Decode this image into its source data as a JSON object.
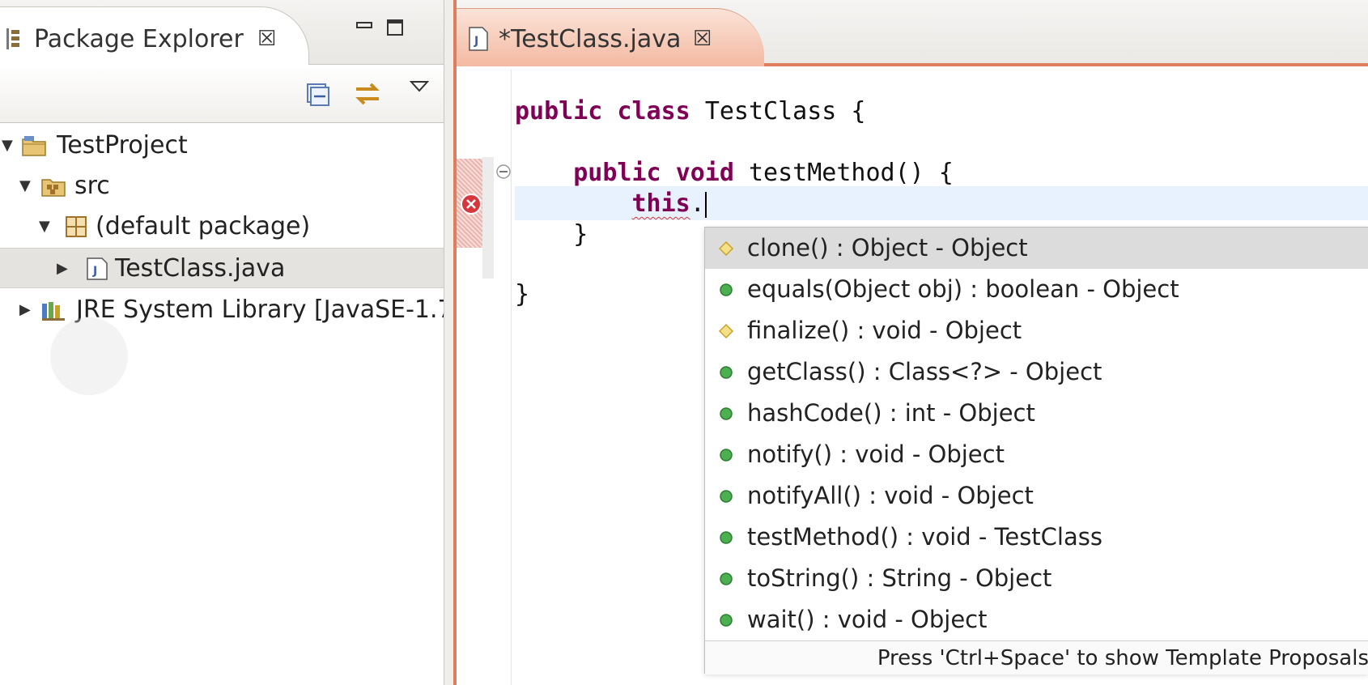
{
  "explorer": {
    "tab_title": "Package Explorer",
    "close_glyph": "☒",
    "tree": [
      {
        "label": "TestProject",
        "twisty": "▼",
        "icon": "project-folder-icon"
      },
      {
        "label": "src",
        "twisty": "▼",
        "icon": "source-folder-icon"
      },
      {
        "label": "(default package)",
        "twisty": "▼",
        "icon": "package-icon"
      },
      {
        "label": "TestClass.java",
        "twisty": "▶",
        "icon": "java-file-icon",
        "selected": true
      },
      {
        "label": "JRE System Library [JavaSE-1.7",
        "twisty": "▶",
        "icon": "library-icon"
      }
    ]
  },
  "editor": {
    "tab_title": "*TestClass.java",
    "close_glyph": "☒",
    "code": {
      "line1_kw1": "public",
      "line1_kw2": "class",
      "line1_rest": "TestClass {",
      "line2_kw1": "public",
      "line2_kw2": "void",
      "line2_rest": "testMethod() {",
      "line3_kw": "this",
      "line3_rest": ".",
      "line4": "}",
      "line5": "}"
    }
  },
  "assist": {
    "proposals": [
      {
        "text": "clone() : Object - Object",
        "icon": "protected-method-icon",
        "selected": true
      },
      {
        "text": "equals(Object obj) : boolean - Object",
        "icon": "public-method-icon"
      },
      {
        "text": "finalize() : void - Object",
        "icon": "protected-method-icon"
      },
      {
        "text": "getClass() : Class<?> - Object",
        "icon": "public-method-icon"
      },
      {
        "text": "hashCode() : int - Object",
        "icon": "public-method-icon"
      },
      {
        "text": "notify() : void - Object",
        "icon": "public-method-icon"
      },
      {
        "text": "notifyAll() : void - Object",
        "icon": "public-method-icon"
      },
      {
        "text": "testMethod() : void - TestClass",
        "icon": "public-method-icon"
      },
      {
        "text": "toString() : String - Object",
        "icon": "public-method-icon"
      },
      {
        "text": "wait() : void - Object",
        "icon": "public-method-icon"
      }
    ],
    "footer": "Press 'Ctrl+Space' to show Template Proposals"
  },
  "colors": {
    "active_editor_accent": "#e07d5c",
    "keyword": "#7f0055",
    "public_method": "#3c9a46",
    "protected_method": "#e8c531",
    "error": "#d6363c"
  }
}
